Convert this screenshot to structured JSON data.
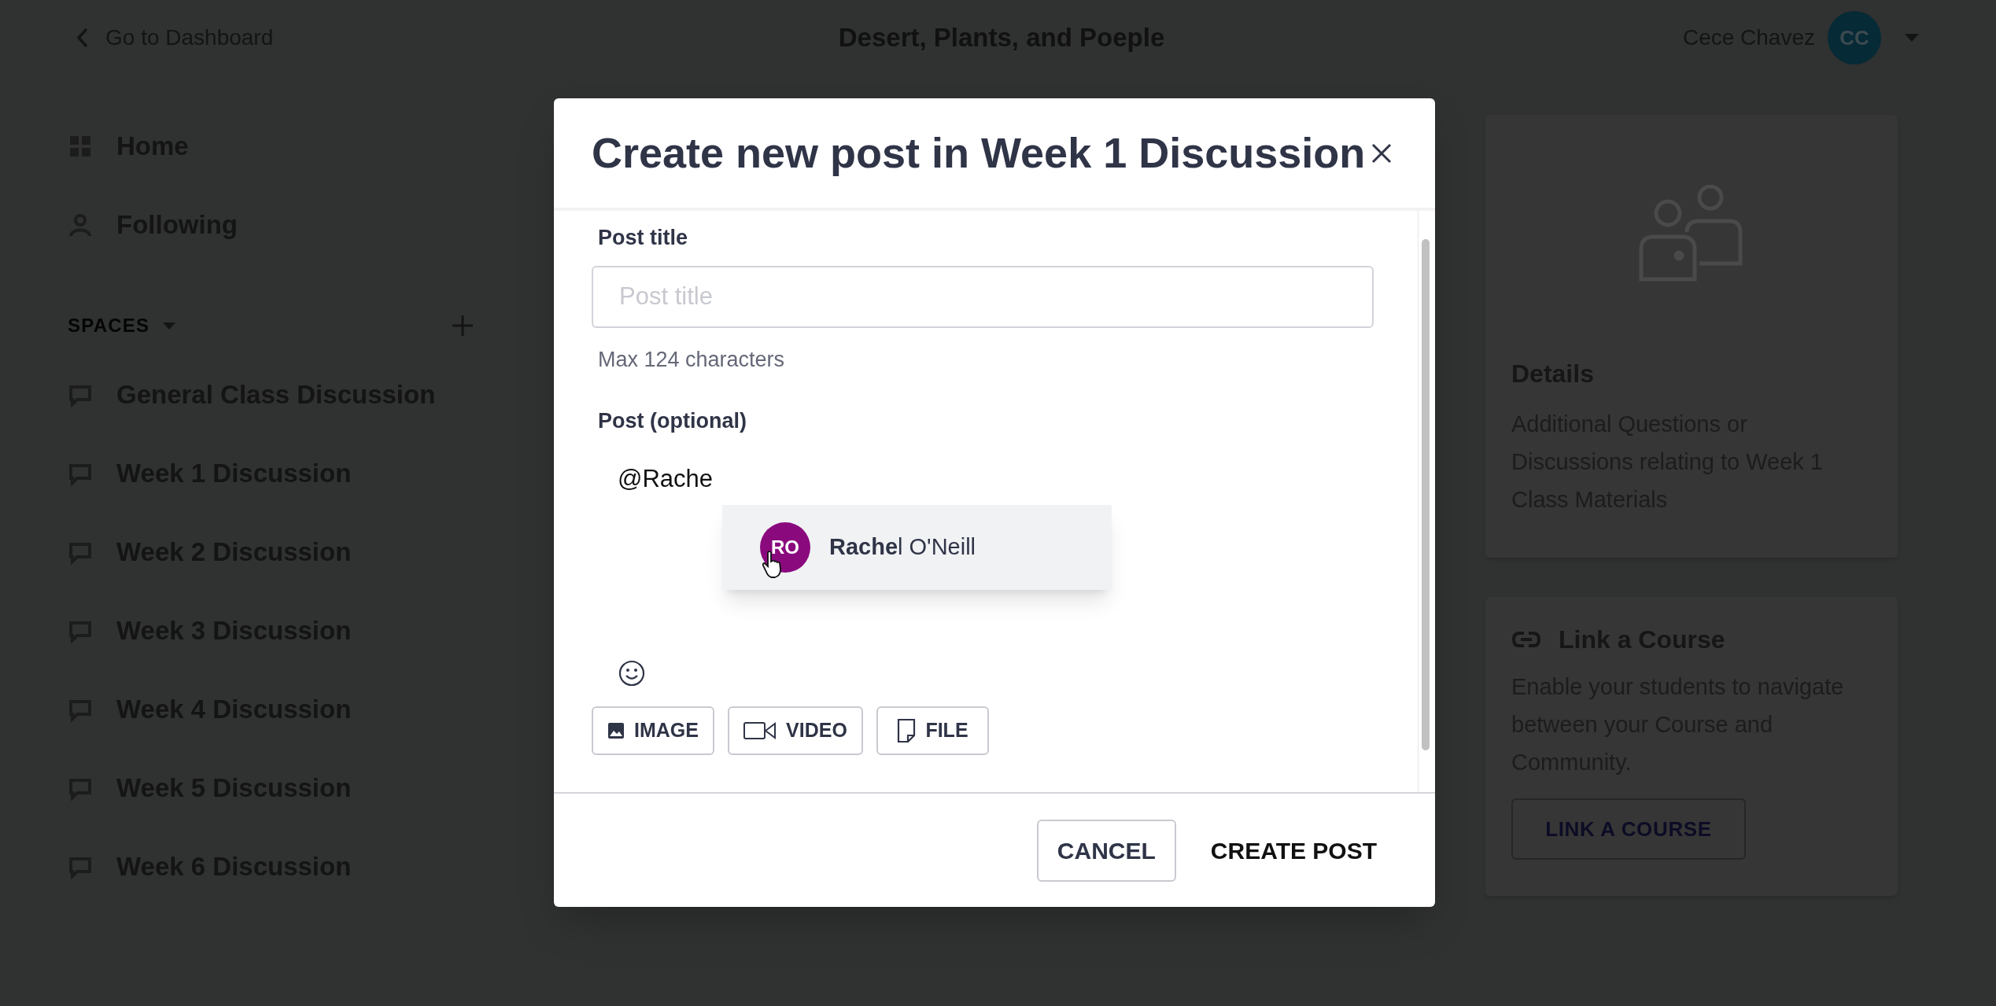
{
  "header": {
    "back_link": "Go to Dashboard",
    "title": "Desert, Plants, and Poeple",
    "user_name": "Cece Chavez",
    "avatar_initials": "CC"
  },
  "sidebar": {
    "items": [
      {
        "label": "Home",
        "kind": "home"
      },
      {
        "label": "Following",
        "kind": "following"
      }
    ],
    "spaces_heading": "SPACES",
    "spaces": [
      {
        "label": "General Class Discussion"
      },
      {
        "label": "Week 1 Discussion"
      },
      {
        "label": "Week 2 Discussion"
      },
      {
        "label": "Week 3 Discussion"
      },
      {
        "label": "Week 4 Discussion"
      },
      {
        "label": "Week 5 Discussion"
      },
      {
        "label": "Week 6 Discussion"
      }
    ]
  },
  "dialog": {
    "title": "Create new post in Week 1 Discussion",
    "post_title_label": "Post title",
    "post_title_field": {
      "placeholder": "Post title"
    },
    "hint": "Max 124 characters",
    "post_label": "Post (optional)",
    "post_value": "@Rache",
    "mention_suggestions": [
      {
        "initials": "RO",
        "name": "**Rache**l O'Neill",
        "selected": true
      }
    ],
    "attachments": [
      {
        "kind": "image",
        "label": "IMAGE"
      },
      {
        "kind": "video",
        "label": "VIDEO"
      },
      {
        "kind": "file",
        "label": "FILE"
      }
    ],
    "buttons": [
      {
        "kind": "secondary",
        "label": "CANCEL"
      },
      {
        "kind": "primary",
        "label": "CREATE POST"
      }
    ]
  },
  "details_card": {
    "title": "Details",
    "text": "Additional Questions or Discussions relating to Week 1 Class Materials"
  },
  "link_course_card": {
    "title": "Link a Course",
    "text": "Enable your students to navigate between your Course and Community.",
    "button": "LINK A COURSE"
  }
}
